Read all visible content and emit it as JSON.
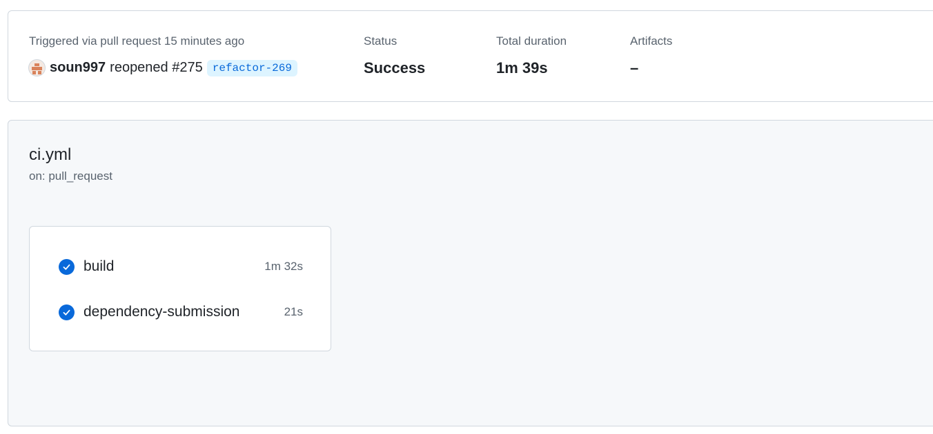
{
  "run_summary": {
    "trigger_label": "Triggered via pull request 15 minutes ago",
    "actor": "soun997",
    "action_text": "reopened #275",
    "branch": "refactor-269",
    "status": {
      "label": "Status",
      "value": "Success"
    },
    "duration": {
      "label": "Total duration",
      "value": "1m 39s"
    },
    "artifacts": {
      "label": "Artifacts",
      "value": "–"
    }
  },
  "workflow": {
    "name": "ci.yml",
    "event": "on: pull_request",
    "jobs": [
      {
        "name": "build",
        "duration": "1m 32s",
        "status": "success",
        "icon": "check-circle-icon"
      },
      {
        "name": "dependency-submission",
        "duration": "21s",
        "status": "success",
        "icon": "check-circle-icon"
      }
    ]
  },
  "colors": {
    "success_icon": "#0969da",
    "branch_bg": "#ddf4ff",
    "branch_text": "#0969da",
    "panel_bg": "#f6f8fa"
  }
}
